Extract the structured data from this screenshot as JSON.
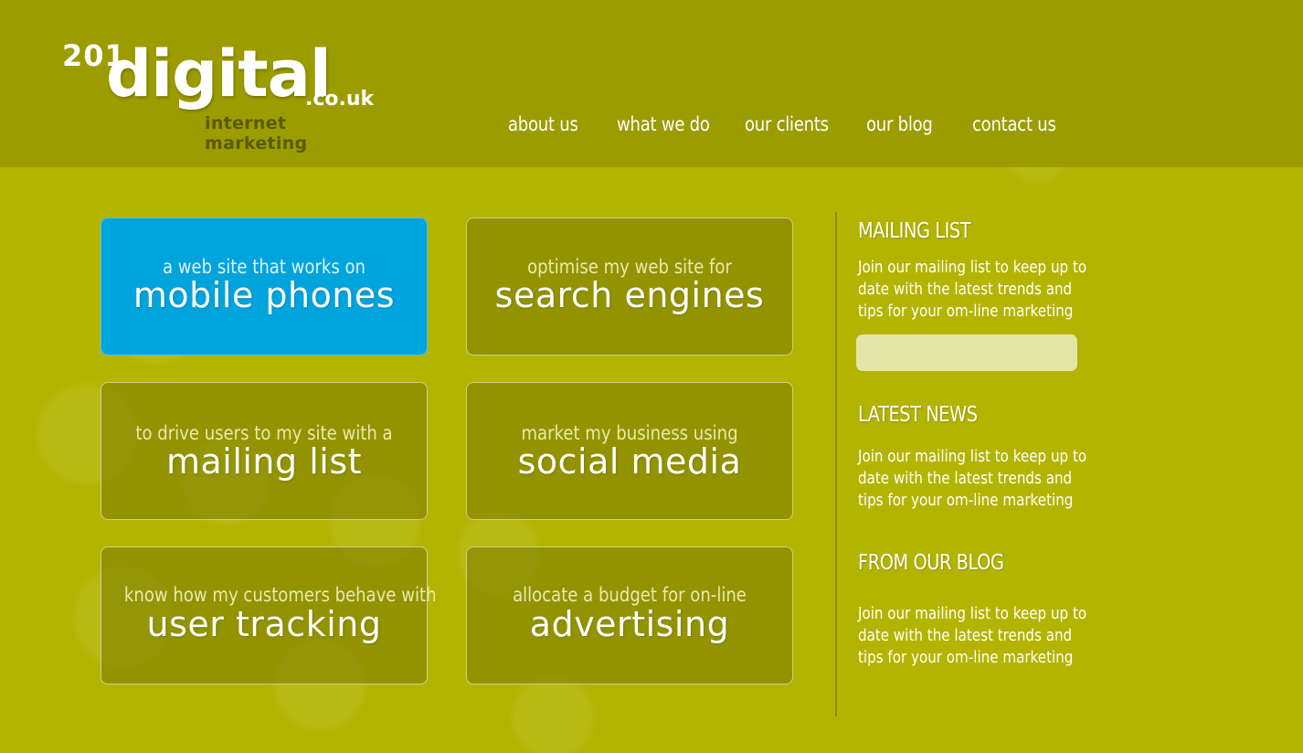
{
  "brand": {
    "number": "201",
    "word": "digital",
    "tld": ".co.uk",
    "tagline": "internet marketing"
  },
  "nav": {
    "items": [
      {
        "label": "about us"
      },
      {
        "label": "what we do"
      },
      {
        "label": "our clients"
      },
      {
        "label": "our blog"
      },
      {
        "label": "contact us"
      }
    ]
  },
  "tiles": [
    {
      "small": "a web site that works on",
      "big": "mobile phones",
      "active": true
    },
    {
      "small": "optimise my web site for",
      "big": "search engines",
      "active": false
    },
    {
      "small": "to drive users to my site with a",
      "big": "mailing list",
      "active": false
    },
    {
      "small": "market my business using",
      "big": "social media",
      "active": false
    },
    {
      "small": "know how my customers behave with",
      "big": "user tracking",
      "active": false
    },
    {
      "small": "allocate a budget for on-line",
      "big": "advertising",
      "active": false
    }
  ],
  "sidebar": {
    "mailing": {
      "title": "MAILING LIST",
      "text": "Join our mailing list to keep up to date with the latest trends and tips for your om-line marketing",
      "input_value": ""
    },
    "news": {
      "title": "LATEST NEWS",
      "text": "Join our mailing list to keep up to date with the latest trends and tips for your om-line marketing"
    },
    "blog": {
      "title": "FROM OUR BLOG",
      "text": "Join our mailing list to keep up to date with the latest trends and tips for your om-line marketing"
    }
  },
  "colors": {
    "header_bg": "#9c9c00",
    "page_bg": "#b3b400",
    "tile_active": "#00a4dc",
    "input_bg": "#e3e5a4"
  }
}
